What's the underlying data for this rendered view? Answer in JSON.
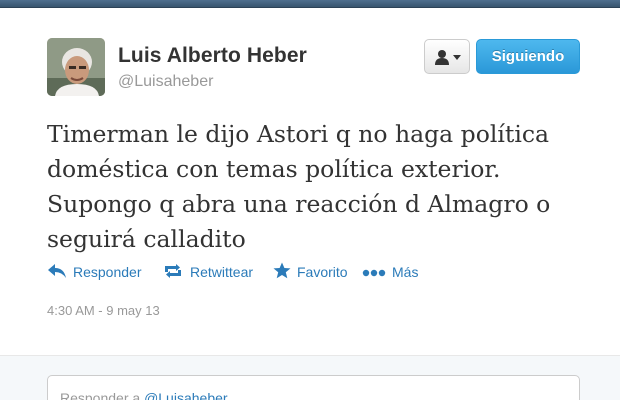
{
  "tweet": {
    "author": {
      "name": "Luis Alberto Heber",
      "handle": "@Luisaheber"
    },
    "text_lines": [
      "Timerman le dijo Astori q no haga política",
      "doméstica con temas política exterior.",
      "Supongo q abra una reacción d Almagro o",
      "seguirá calladito"
    ],
    "timestamp": "4:30 AM - 9 may 13"
  },
  "buttons": {
    "follow_label": "Siguiendo",
    "user_menu_icon": "person-dropdown-icon"
  },
  "actions": [
    {
      "label": "Responder",
      "icon": "reply-icon"
    },
    {
      "label": "Retwittear",
      "icon": "retweet-icon"
    },
    {
      "label": "Favorito",
      "icon": "star-icon"
    },
    {
      "label": "Más",
      "icon": "more-dots-icon"
    }
  ],
  "reply": {
    "placeholder_prefix": "Responder a ",
    "mention": "@Luisaheber"
  },
  "colors": {
    "link": "#2b7bb9",
    "follow_button": "#2a98d8",
    "text": "#333333",
    "muted": "#999999"
  }
}
